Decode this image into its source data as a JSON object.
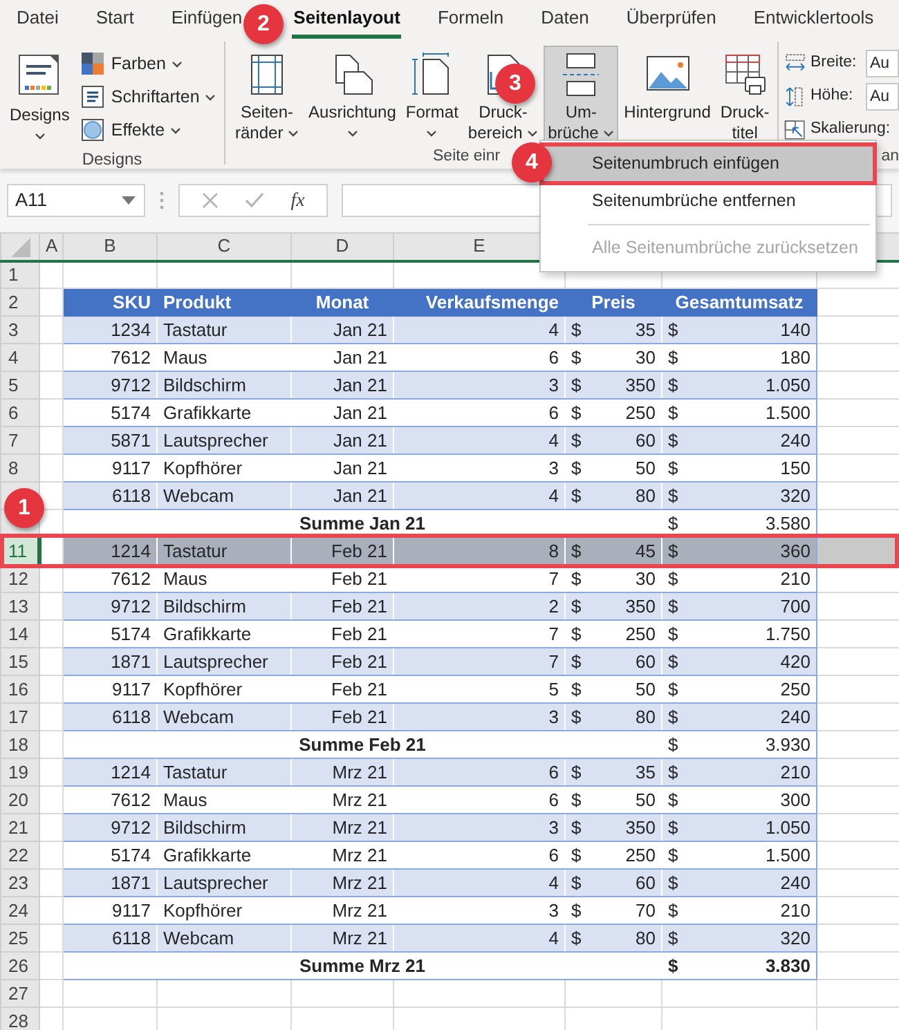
{
  "tabs": [
    {
      "label": "Datei",
      "selected": false
    },
    {
      "label": "Start",
      "selected": false
    },
    {
      "label": "Einfügen",
      "selected": false
    },
    {
      "label": "Seitenlayout",
      "selected": true
    },
    {
      "label": "Formeln",
      "selected": false
    },
    {
      "label": "Daten",
      "selected": false
    },
    {
      "label": "Überprüfen",
      "selected": false
    },
    {
      "label": "Entwicklertools",
      "selected": false
    }
  ],
  "ribbon": {
    "groups": [
      {
        "label": "Designs",
        "buttons": [
          {
            "kind": "large",
            "lines": [
              "Designs"
            ],
            "dropdown": true,
            "pressed": false
          },
          {
            "kind": "small",
            "label": "Farben",
            "dropdown": true
          },
          {
            "kind": "small",
            "label": "Schriftarten",
            "dropdown": true
          },
          {
            "kind": "small",
            "label": "Effekte",
            "dropdown": true
          }
        ]
      },
      {
        "label": "Seite einr",
        "buttons": [
          {
            "kind": "large",
            "lines": [
              "Seiten-",
              "ränder"
            ],
            "dropdown": true,
            "pressed": false
          },
          {
            "kind": "large",
            "lines": [
              "Ausrichtung"
            ],
            "dropdown": true,
            "pressed": false
          },
          {
            "kind": "large",
            "lines": [
              "Format"
            ],
            "dropdown": true,
            "pressed": false
          },
          {
            "kind": "large",
            "lines": [
              "Druck-",
              "bereich"
            ],
            "dropdown": true,
            "pressed": false
          },
          {
            "kind": "large",
            "lines": [
              "Um-",
              "brüche"
            ],
            "dropdown": true,
            "pressed": true
          },
          {
            "kind": "large",
            "lines": [
              "Hintergrund"
            ],
            "dropdown": false,
            "pressed": false
          },
          {
            "kind": "large",
            "lines": [
              "Druck-",
              "titel"
            ],
            "dropdown": false,
            "pressed": false
          }
        ]
      },
      {
        "label": "an",
        "buttons": [
          {
            "kind": "field",
            "label": "Breite:",
            "value": "Au"
          },
          {
            "kind": "field",
            "label": "Höhe:",
            "value": "Au"
          },
          {
            "kind": "small",
            "label": "Skalierung:",
            "dropdown": false
          }
        ]
      }
    ]
  },
  "formula_bar": {
    "name_box": "A11",
    "function_label": "fx"
  },
  "sheet": {
    "columns": [
      "A",
      "B",
      "C",
      "D",
      "E"
    ],
    "rows": [
      {
        "number": "1",
        "kind": "blank",
        "selected": false
      },
      {
        "number": "2",
        "kind": "header",
        "selected": false,
        "cells": [
          "SKU",
          "Produkt",
          "Monat",
          "Verkaufsmenge",
          "Preis",
          "Gesamtumsatz"
        ]
      },
      {
        "number": "3",
        "kind": "data",
        "selected": false,
        "cells": [
          "1234",
          "Tastatur",
          "Jan 21",
          "4",
          "$",
          "35",
          "$",
          "140"
        ]
      },
      {
        "number": "4",
        "kind": "data",
        "selected": false,
        "cells": [
          "7612",
          "Maus",
          "Jan 21",
          "6",
          "$",
          "30",
          "$",
          "180"
        ]
      },
      {
        "number": "5",
        "kind": "data",
        "selected": false,
        "cells": [
          "9712",
          "Bildschirm",
          "Jan 21",
          "3",
          "$",
          "350",
          "$",
          "1.050"
        ]
      },
      {
        "number": "6",
        "kind": "data",
        "selected": false,
        "cells": [
          "5174",
          "Grafikkarte",
          "Jan 21",
          "6",
          "$",
          "250",
          "$",
          "1.500"
        ]
      },
      {
        "number": "7",
        "kind": "data",
        "selected": false,
        "cells": [
          "5871",
          "Lautsprecher",
          "Jan 21",
          "4",
          "$",
          "60",
          "$",
          "240"
        ]
      },
      {
        "number": "8",
        "kind": "data",
        "selected": false,
        "cells": [
          "9117",
          "Kopfhörer",
          "Jan 21",
          "3",
          "$",
          "50",
          "$",
          "150"
        ]
      },
      {
        "kind": "data",
        "selected": false,
        "cells": [
          "6118",
          "Webcam",
          "Jan 21",
          "4",
          "$",
          "80",
          "$",
          "320"
        ]
      },
      {
        "kind": "total",
        "selected": false,
        "bold_total": false,
        "cells": [
          "Summe Jan 21",
          "$",
          "3.580"
        ]
      },
      {
        "number": "11",
        "kind": "data",
        "selected": true,
        "cells": [
          "1214",
          "Tastatur",
          "Feb 21",
          "8",
          "$",
          "45",
          "$",
          "360"
        ]
      },
      {
        "number": "12",
        "kind": "data",
        "selected": false,
        "cells": [
          "7612",
          "Maus",
          "Feb 21",
          "7",
          "$",
          "30",
          "$",
          "210"
        ]
      },
      {
        "number": "13",
        "kind": "data",
        "selected": false,
        "cells": [
          "9712",
          "Bildschirm",
          "Feb 21",
          "2",
          "$",
          "350",
          "$",
          "700"
        ]
      },
      {
        "number": "14",
        "kind": "data",
        "selected": false,
        "cells": [
          "5174",
          "Grafikkarte",
          "Feb 21",
          "7",
          "$",
          "250",
          "$",
          "1.750"
        ]
      },
      {
        "number": "15",
        "kind": "data",
        "selected": false,
        "cells": [
          "1871",
          "Lautsprecher",
          "Feb 21",
          "7",
          "$",
          "60",
          "$",
          "420"
        ]
      },
      {
        "number": "16",
        "kind": "data",
        "selected": false,
        "cells": [
          "9117",
          "Kopfhörer",
          "Feb 21",
          "5",
          "$",
          "50",
          "$",
          "250"
        ]
      },
      {
        "number": "17",
        "kind": "data",
        "selected": false,
        "cells": [
          "6118",
          "Webcam",
          "Feb 21",
          "3",
          "$",
          "80",
          "$",
          "240"
        ]
      },
      {
        "number": "18",
        "kind": "total",
        "selected": false,
        "bold_total": false,
        "cells": [
          "Summe Feb 21",
          "$",
          "3.930"
        ]
      },
      {
        "number": "19",
        "kind": "data",
        "selected": false,
        "cells": [
          "1214",
          "Tastatur",
          "Mrz 21",
          "6",
          "$",
          "35",
          "$",
          "210"
        ]
      },
      {
        "number": "20",
        "kind": "data",
        "selected": false,
        "cells": [
          "7612",
          "Maus",
          "Mrz 21",
          "6",
          "$",
          "50",
          "$",
          "300"
        ]
      },
      {
        "number": "21",
        "kind": "data",
        "selected": false,
        "cells": [
          "9712",
          "Bildschirm",
          "Mrz 21",
          "3",
          "$",
          "350",
          "$",
          "1.050"
        ]
      },
      {
        "number": "22",
        "kind": "data",
        "selected": false,
        "cells": [
          "5174",
          "Grafikkarte",
          "Mrz 21",
          "6",
          "$",
          "250",
          "$",
          "1.500"
        ]
      },
      {
        "number": "23",
        "kind": "data",
        "selected": false,
        "cells": [
          "1871",
          "Lautsprecher",
          "Mrz 21",
          "4",
          "$",
          "60",
          "$",
          "240"
        ]
      },
      {
        "number": "24",
        "kind": "data",
        "selected": false,
        "cells": [
          "9117",
          "Kopfhörer",
          "Mrz 21",
          "3",
          "$",
          "70",
          "$",
          "210"
        ]
      },
      {
        "number": "25",
        "kind": "data",
        "selected": false,
        "cells": [
          "6118",
          "Webcam",
          "Mrz 21",
          "4",
          "$",
          "80",
          "$",
          "320"
        ]
      },
      {
        "number": "26",
        "kind": "total",
        "selected": false,
        "bold_total": true,
        "cells": [
          "Summe Mrz 21",
          "$",
          "3.830"
        ]
      },
      {
        "number": "27",
        "kind": "blank",
        "selected": false
      },
      {
        "number": "28",
        "kind": "blank",
        "selected": false
      }
    ]
  },
  "menu": {
    "items": [
      {
        "label": "Seitenumbruch einfügen",
        "selected": true,
        "disabled": false,
        "separator_before": false
      },
      {
        "label": "Seitenumbrüche entfernen",
        "selected": false,
        "disabled": false,
        "separator_before": false
      },
      {
        "label": "Alle Seitenumbrüche zurücksetzen",
        "selected": false,
        "disabled": true,
        "separator_before": true
      }
    ]
  },
  "callouts": [
    {
      "number": "1"
    },
    {
      "number": "2"
    },
    {
      "number": "3"
    },
    {
      "number": "4"
    }
  ]
}
